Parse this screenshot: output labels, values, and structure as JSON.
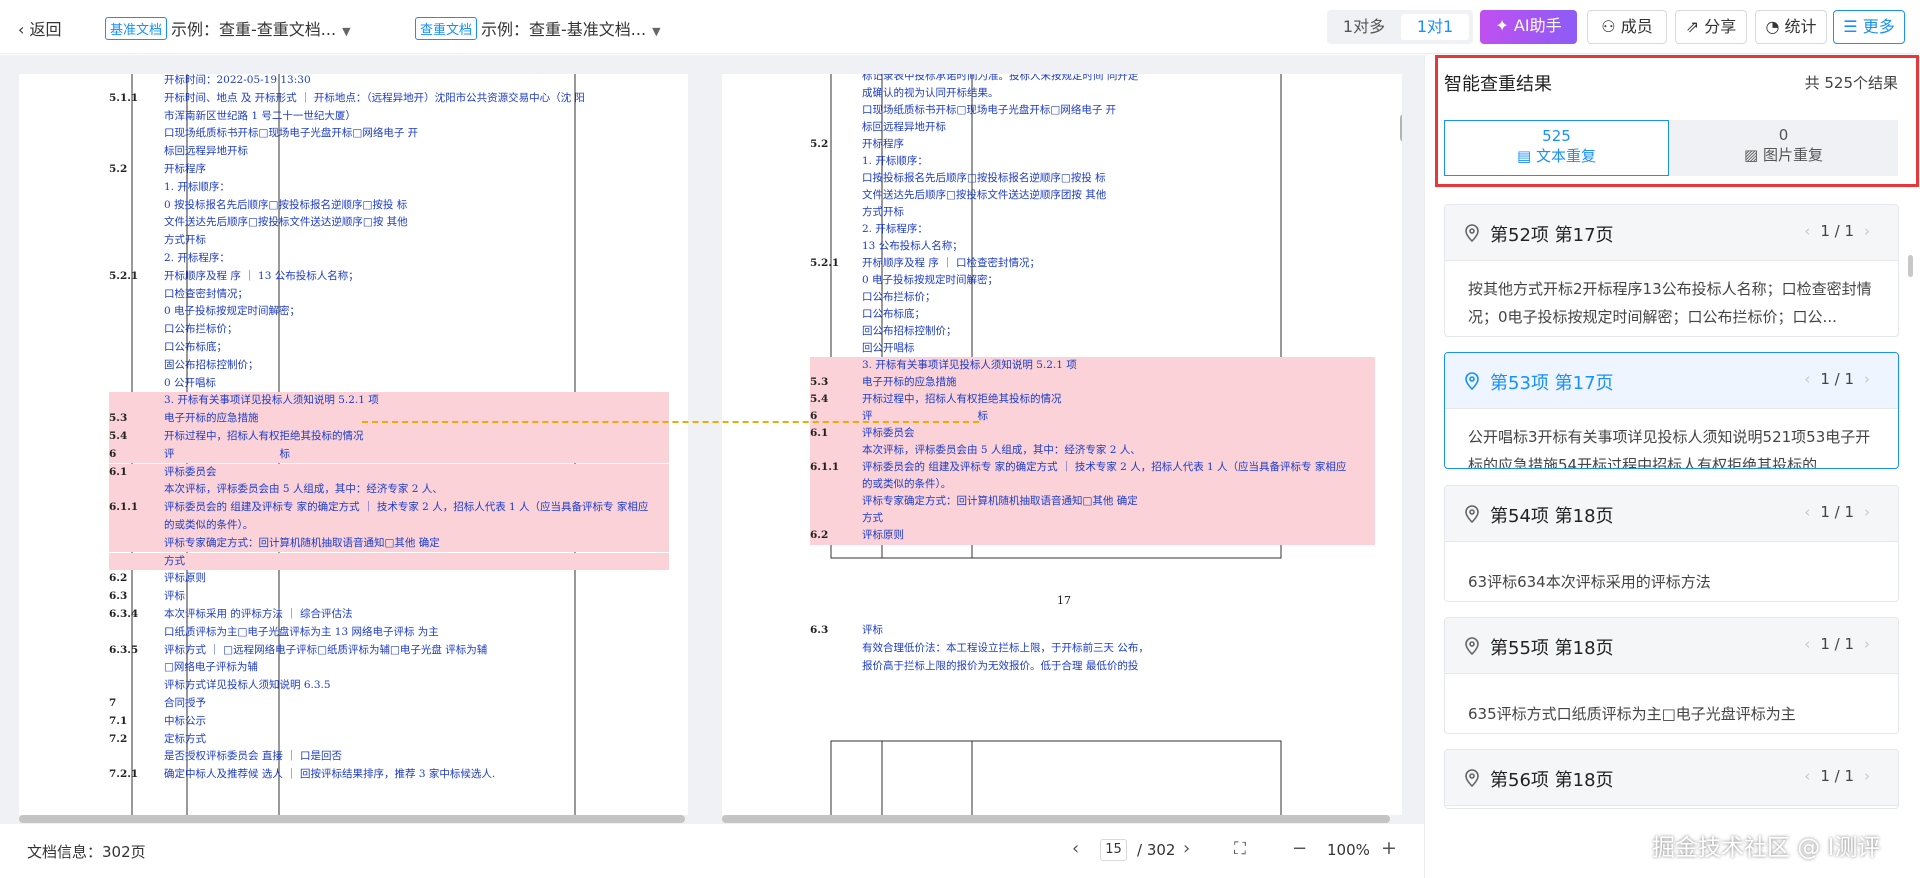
{
  "header": {
    "back": "返回",
    "base_tag": "基准文档",
    "base_name": "示例：查重-查重文档...",
    "check_tag": "查重文档",
    "check_name": "示例：查重-基准文档...",
    "mode_many": "1对多",
    "mode_one": "1对1",
    "ai": "AI助手",
    "members": "成员",
    "share": "分享",
    "stats": "统计",
    "more": "更多"
  },
  "left_page": {
    "lines": [
      {
        "label": "",
        "text": "开标时间：2022-05-19 13:30"
      },
      {
        "label": "5.1.1",
        "text": "开标时间、地点 及 开标形式 ｜ 开标地点：（远程异地开）沈阳市公共资源交易中心（沈 阳"
      },
      {
        "label": "",
        "text": "市浑南新区世纪路 1 号二十一世纪大厦）"
      },
      {
        "label": "",
        "text": "口现场纸质标书开标□现场电子光盘开标□网络电子 开"
      },
      {
        "label": "",
        "text": "标回远程异地开标"
      },
      {
        "label": "5.2",
        "text": "开标程序"
      },
      {
        "label": "",
        "text": "1. 开标顺序："
      },
      {
        "label": "",
        "text": "0 按投标报名先后顺序□按投标报名逆顺序□按投 标"
      },
      {
        "label": "",
        "text": "文件送达先后顺序□按投标文件送达逆顺序□按 其他"
      },
      {
        "label": "",
        "text": "方式开标"
      },
      {
        "label": "",
        "text": "2. 开标程序："
      },
      {
        "label": "5.2.1",
        "text": "开标顺序及程 序 ｜ 13 公布投标人名称；"
      },
      {
        "label": "",
        "text": "口检查密封情况；"
      },
      {
        "label": "",
        "text": "0 电子投标按规定时间解密；"
      },
      {
        "label": "",
        "text": "口公布拦标价；"
      },
      {
        "label": "",
        "text": "口公布标底；"
      },
      {
        "label": "",
        "text": "固公布招标控制价；"
      },
      {
        "label": "",
        "text": "0 公开唱标"
      },
      {
        "label": "",
        "text": "3. 开标有关事项详见投标人须知说明 5.2.1 项"
      },
      {
        "label": "5.3",
        "text": "电子开标的应急措施"
      },
      {
        "label": "5.4",
        "text": "开标过程中，招标人有权拒绝其投标的情况"
      },
      {
        "label": "6",
        "text": "评　　　　　　　　　　标"
      },
      {
        "label": "6.1",
        "text": "评标委员会"
      },
      {
        "label": "",
        "text": "本次评标，评标委员会由 5 人组成，其中：经济专家 2 人、"
      },
      {
        "label": "6.1.1",
        "text": "评标委员会的 组建及评标专 家的确定方式 ｜ 技术专家 2 人，招标人代表 1 人（应当具备评标专 家相应"
      },
      {
        "label": "",
        "text": "的或类似的条件）。"
      },
      {
        "label": "",
        "text": "评标专家确定方式：回计算机随机抽取语音通知□其他 确定"
      },
      {
        "label": "",
        "text": "方式"
      },
      {
        "label": "6.2",
        "text": "评标原则"
      },
      {
        "label": "6.3",
        "text": "评标"
      },
      {
        "label": "6.3.4",
        "text": "本次评标采用 的评标方法 ｜ 综合评估法"
      },
      {
        "label": "",
        "text": "口纸质评标为主□电子光盘评标为主 13 网络电子评标 为主"
      },
      {
        "label": "6.3.5",
        "text": "评标方式 ｜ □远程网络电子评标□纸质评标为辅□电子光盘 评标为辅"
      },
      {
        "label": "",
        "text": "□网络电子评标为辅"
      },
      {
        "label": "",
        "text": "评标方式详见投标人须知说明 6.3.5"
      },
      {
        "label": "7",
        "text": "合同授予"
      },
      {
        "label": "7.1",
        "text": "中标公示"
      },
      {
        "label": "7.2",
        "text": "定标方式"
      },
      {
        "label": "",
        "text": "是否授权评标委员会 直接 ｜ 口是回否"
      },
      {
        "label": "7.2.1",
        "text": "确定中标人及推荐候 选人 ｜ 回按评标结果排序，推荐 3 家中标候选人."
      }
    ]
  },
  "right_page": {
    "page_no": "17",
    "lines": [
      {
        "label": "",
        "text": "标记录表中投标承诺时间为准。投标人未按规定时间 同开走"
      },
      {
        "label": "",
        "text": "成确认的视为认同开标结果。"
      },
      {
        "label": "",
        "text": "口现场纸质标书开标□现场电子光盘开标□网络电子 开"
      },
      {
        "label": "",
        "text": "标回远程异地开标"
      },
      {
        "label": "5.2",
        "text": "开标程序"
      },
      {
        "label": "",
        "text": "1. 开标顺序："
      },
      {
        "label": "",
        "text": "口按投标报名先后顺序□按投标报名逆顺序□按投 标"
      },
      {
        "label": "",
        "text": "文件送达先后顺序□按投标文件送达逆顺序团按 其他"
      },
      {
        "label": "",
        "text": "方式开标"
      },
      {
        "label": "",
        "text": "2. 开标程序："
      },
      {
        "label": "",
        "text": "13 公布投标人名称；"
      },
      {
        "label": "5.2.1",
        "text": "开标顺序及程 序 ｜ 口检查密封情况；"
      },
      {
        "label": "",
        "text": "0 电子投标按规定时间解密；"
      },
      {
        "label": "",
        "text": "口公布拦标价；"
      },
      {
        "label": "",
        "text": "口公布标底；"
      },
      {
        "label": "",
        "text": "回公布招标控制价；"
      },
      {
        "label": "",
        "text": "回公开唱标"
      },
      {
        "label": "",
        "text": "3. 开标有关事项详见投标人须知说明 5.2.1 项"
      },
      {
        "label": "5.3",
        "text": "电子开标的应急措施"
      },
      {
        "label": "5.4",
        "text": "开标过程中，招标人有权拒绝其投标的情况"
      },
      {
        "label": "6",
        "text": "评　　　　　　　　　　标"
      },
      {
        "label": "6.1",
        "text": "评标委员会"
      },
      {
        "label": "",
        "text": "本次评标，评标委员会由 5 人组成，其中：经济专家 2 人、"
      },
      {
        "label": "6.1.1",
        "text": "评标委员会的 组建及评标专 家的确定方式 ｜ 技术专家 2 人，招标人代表 1 人（应当具备评标专 家相应"
      },
      {
        "label": "",
        "text": "的或类似的条件）。"
      },
      {
        "label": "",
        "text": "评标专家确定方式：回计算机随机抽取语音通知□其他 确定"
      },
      {
        "label": "",
        "text": "方式"
      },
      {
        "label": "6.2",
        "text": "评标原则"
      }
    ],
    "lines2": [
      {
        "label": "6.3",
        "text": "评标"
      },
      {
        "label": "",
        "text": "有效合理低价法：本工程设立拦标上限，于开标前三天 公布，"
      },
      {
        "label": "",
        "text": "报价高于拦标上限的报价为无效报价。低于合理 最低价的投"
      }
    ]
  },
  "footer": {
    "doc_info": "文档信息：302页",
    "page_current": "15",
    "page_total": "/ 302",
    "zoom": "100%"
  },
  "results": {
    "title": "智能查重结果",
    "total": "共 525个结果",
    "text_count": "525",
    "text_label": "文本重复",
    "image_count": "0",
    "image_label": "图片重复",
    "items": [
      {
        "title": "第52项 第17页",
        "nav": "1 / 1",
        "text": "按其他方式开标2开标程序13公布投标人名称；口检查密封情况；0电子投标按规定时间解密；口公布拦标价；口公..."
      },
      {
        "title": "第53项 第17页",
        "nav": "1 / 1",
        "text": "公开唱标3开标有关事项详见投标人须知说明521项53电子开标的应急措施54开标过程中招标人有权拒绝其投标的..."
      },
      {
        "title": "第54项 第18页",
        "nav": "1 / 1",
        "text": "63评标634本次评标采用的评标方法"
      },
      {
        "title": "第55项 第18页",
        "nav": "1 / 1",
        "text": "635评标方式口纸质评标为主□电子光盘评标为主"
      },
      {
        "title": "第56项 第18页",
        "nav": "1 / 1",
        "text": ""
      }
    ]
  },
  "watermark": "掘金技术社区 @ I测评"
}
